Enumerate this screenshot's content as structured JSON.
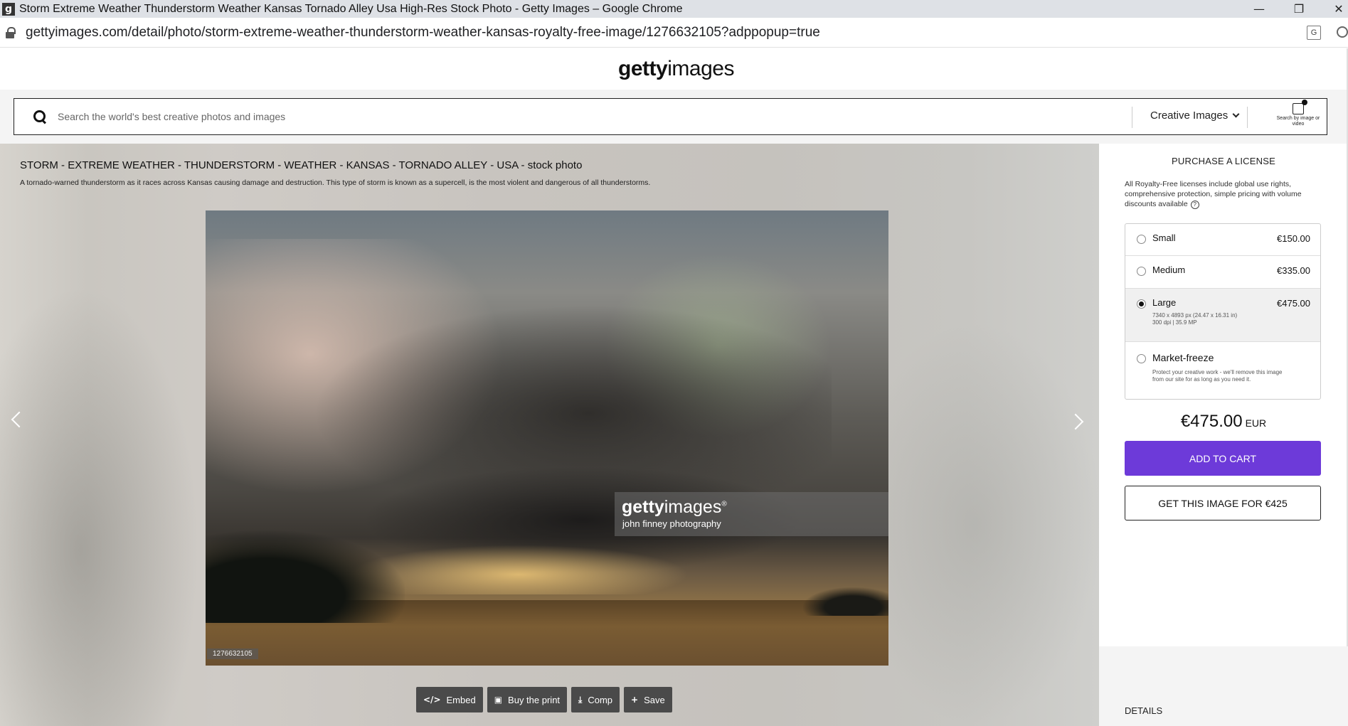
{
  "browser": {
    "favicon_letter": "g",
    "window_title": "Storm Extreme Weather Thunderstorm Weather Kansas Tornado Alley Usa High-Res Stock Photo - Getty Images – Google Chrome",
    "url": "gettyimages.com/detail/photo/storm-extreme-weather-thunderstorm-weather-kansas-royalty-free-image/1276632105?adppopup=true",
    "translate_icon_text": "G"
  },
  "header": {
    "logo_bold": "getty",
    "logo_light": "images"
  },
  "search": {
    "placeholder": "Search the world's best creative photos and images",
    "type_label": "Creative Images",
    "search_by_image_label": "Search by image or video"
  },
  "image": {
    "title": "STORM - EXTREME WEATHER - THUNDERSTORM - WEATHER - KANSAS - TORNADO ALLEY - USA - stock photo",
    "description": "A tornado-warned thunderstorm as it races across Kansas causing damage and destruction. This type of storm is known as a supercell, is the most violent and dangerous of all thunderstorms.",
    "watermark_bold": "getty",
    "watermark_light": "images",
    "watermark_mark": "®",
    "watermark_credit": "john finney photography",
    "id": "1276632105"
  },
  "actions": {
    "embed": "Embed",
    "buy_print": "Buy the print",
    "comp": "Comp",
    "save": "Save",
    "embed_icon": "</>",
    "save_icon": "+"
  },
  "license": {
    "title": "PURCHASE A LICENSE",
    "description": "All Royalty-Free licenses include global use rights, comprehensive protection, simple pricing with volume discounts available",
    "sizes": [
      {
        "name": "Small",
        "price": "€150.00",
        "selected": false
      },
      {
        "name": "Medium",
        "price": "€335.00",
        "selected": false
      },
      {
        "name": "Large",
        "price": "€475.00",
        "selected": true,
        "detail_line1": "7340 x 4893 px (24.47 x 16.31 in)",
        "detail_line2": "300 dpi | 35.9 MP"
      },
      {
        "name": "Market-freeze",
        "price": "",
        "selected": false,
        "detail": "Protect your creative work - we'll remove this image from our site for as long as you need it."
      }
    ],
    "total_amount": "€475.00",
    "total_currency": "EUR",
    "add_to_cart": "ADD TO CART",
    "get_image": "GET THIS IMAGE FOR €425",
    "details_heading": "DETAILS"
  }
}
